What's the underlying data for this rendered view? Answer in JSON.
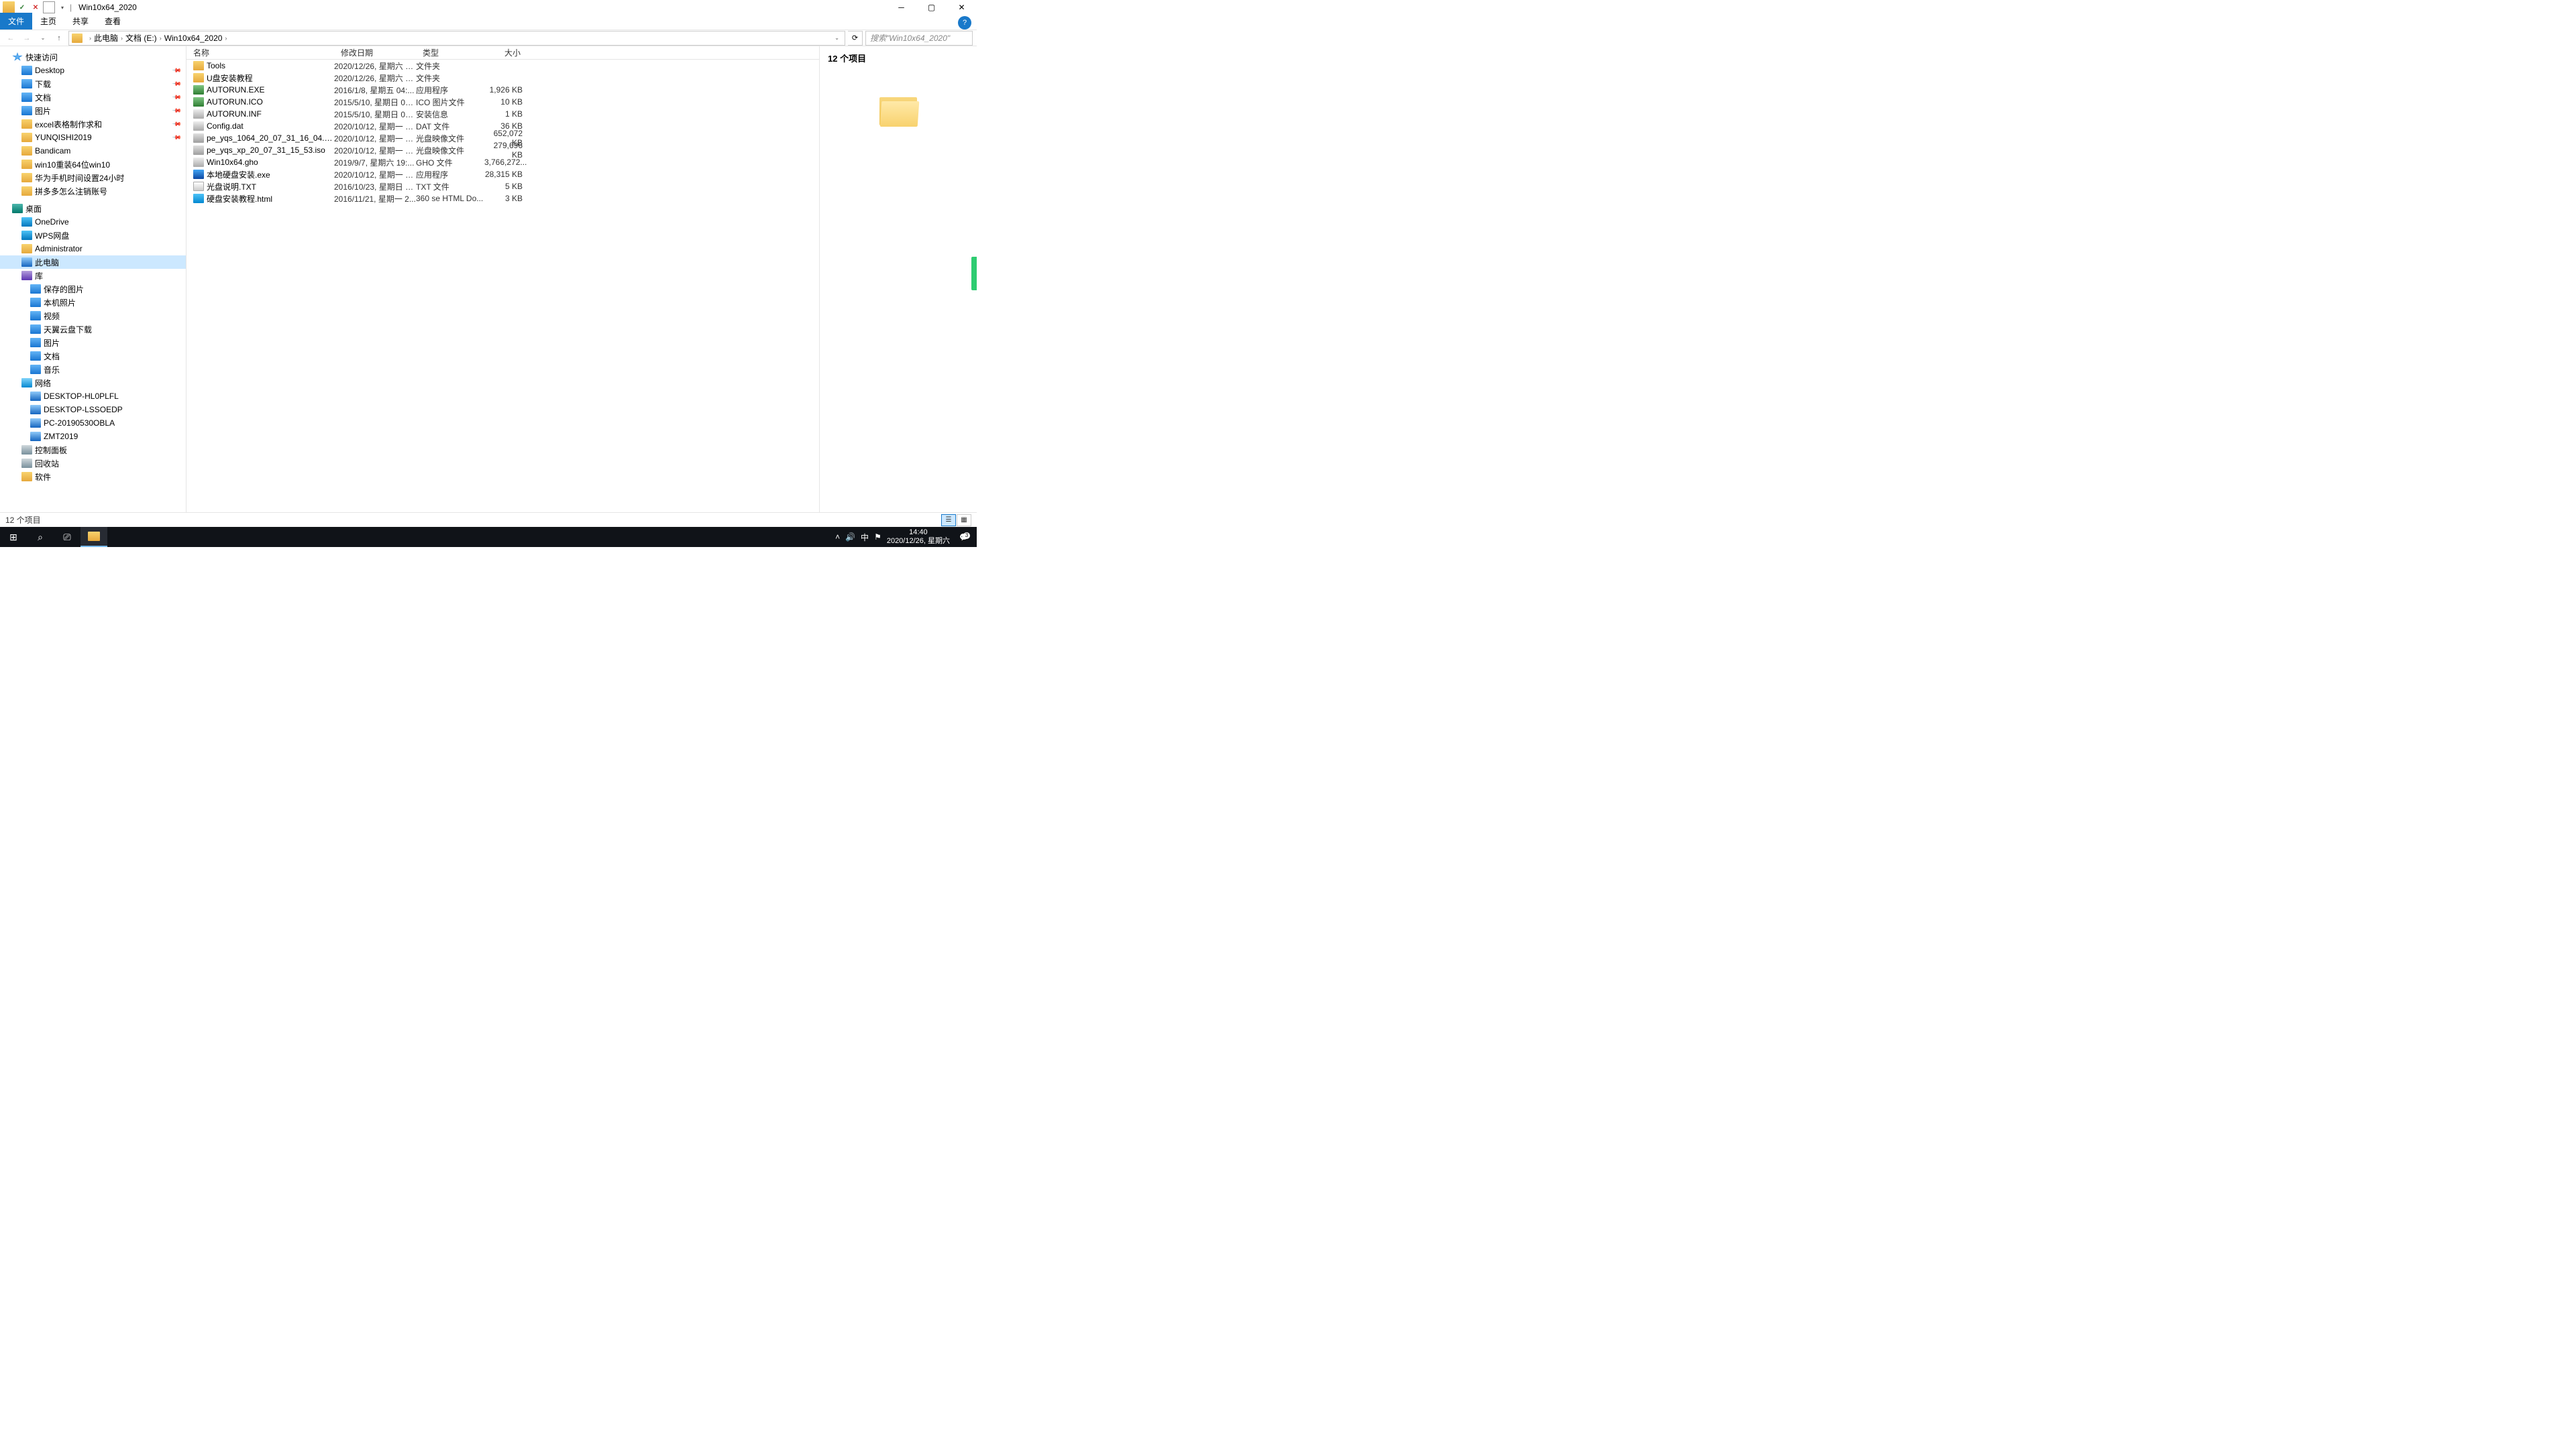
{
  "window": {
    "title": "Win10x64_2020"
  },
  "ribbon": {
    "tabs": [
      "文件",
      "主页",
      "共享",
      "查看"
    ],
    "active": 0
  },
  "breadcrumb": {
    "items": [
      "此电脑",
      "文档 (E:)",
      "Win10x64_2020"
    ]
  },
  "search": {
    "placeholder": "搜索\"Win10x64_2020\""
  },
  "navtree": [
    {
      "label": "快速访问",
      "level": 1,
      "icon": "ic-star"
    },
    {
      "label": "Desktop",
      "level": 2,
      "icon": "ic-blue",
      "pin": true
    },
    {
      "label": "下载",
      "level": 2,
      "icon": "ic-blue",
      "pin": true
    },
    {
      "label": "文档",
      "level": 2,
      "icon": "ic-blue",
      "pin": true
    },
    {
      "label": "图片",
      "level": 2,
      "icon": "ic-blue",
      "pin": true
    },
    {
      "label": "excel表格制作求和",
      "level": 2,
      "icon": "ic-folder",
      "pin": true
    },
    {
      "label": "YUNQISHI2019",
      "level": 2,
      "icon": "ic-folder",
      "pin": true
    },
    {
      "label": "Bandicam",
      "level": 2,
      "icon": "ic-folder"
    },
    {
      "label": "win10重装64位win10",
      "level": 2,
      "icon": "ic-folder"
    },
    {
      "label": "华为手机时间设置24小时",
      "level": 2,
      "icon": "ic-folder"
    },
    {
      "label": "拼多多怎么注销账号",
      "level": 2,
      "icon": "ic-folder"
    },
    {
      "label": "",
      "level": 0,
      "spacer": true
    },
    {
      "label": "桌面",
      "level": 1,
      "icon": "ic-desktop"
    },
    {
      "label": "OneDrive",
      "level": 2,
      "icon": "ic-cloud"
    },
    {
      "label": "WPS网盘",
      "level": 2,
      "icon": "ic-cloud"
    },
    {
      "label": "Administrator",
      "level": 2,
      "icon": "ic-folder"
    },
    {
      "label": "此电脑",
      "level": 2,
      "icon": "ic-pc",
      "selected": true
    },
    {
      "label": "库",
      "level": 2,
      "icon": "ic-lib"
    },
    {
      "label": "保存的图片",
      "level": 3,
      "icon": "ic-blue"
    },
    {
      "label": "本机照片",
      "level": 3,
      "icon": "ic-blue"
    },
    {
      "label": "视频",
      "level": 3,
      "icon": "ic-blue"
    },
    {
      "label": "天翼云盘下载",
      "level": 3,
      "icon": "ic-blue"
    },
    {
      "label": "图片",
      "level": 3,
      "icon": "ic-blue"
    },
    {
      "label": "文档",
      "level": 3,
      "icon": "ic-blue"
    },
    {
      "label": "音乐",
      "level": 3,
      "icon": "ic-blue"
    },
    {
      "label": "网络",
      "level": 2,
      "icon": "ic-net"
    },
    {
      "label": "DESKTOP-HL0PLFL",
      "level": 3,
      "icon": "ic-pc"
    },
    {
      "label": "DESKTOP-LSSOEDP",
      "level": 3,
      "icon": "ic-pc"
    },
    {
      "label": "PC-20190530OBLA",
      "level": 3,
      "icon": "ic-pc"
    },
    {
      "label": "ZMT2019",
      "level": 3,
      "icon": "ic-pc"
    },
    {
      "label": "控制面板",
      "level": 2,
      "icon": "ic-disk"
    },
    {
      "label": "回收站",
      "level": 2,
      "icon": "ic-disk"
    },
    {
      "label": "软件",
      "level": 2,
      "icon": "ic-folder"
    }
  ],
  "columns": {
    "name": "名称",
    "date": "修改日期",
    "type": "类型",
    "size": "大小"
  },
  "files": [
    {
      "name": "Tools",
      "date": "2020/12/26, 星期六 1...",
      "type": "文件夹",
      "size": "",
      "icon": "ic-folder"
    },
    {
      "name": "U盘安装教程",
      "date": "2020/12/26, 星期六 1...",
      "type": "文件夹",
      "size": "",
      "icon": "ic-folder"
    },
    {
      "name": "AUTORUN.EXE",
      "date": "2016/1/8, 星期五 04:...",
      "type": "应用程序",
      "size": "1,926 KB",
      "icon": "ic-exe"
    },
    {
      "name": "AUTORUN.ICO",
      "date": "2015/5/10, 星期日 02...",
      "type": "ICO 图片文件",
      "size": "10 KB",
      "icon": "ic-exe"
    },
    {
      "name": "AUTORUN.INF",
      "date": "2015/5/10, 星期日 02...",
      "type": "安装信息",
      "size": "1 KB",
      "icon": "ic-dat"
    },
    {
      "name": "Config.dat",
      "date": "2020/10/12, 星期一 1...",
      "type": "DAT 文件",
      "size": "36 KB",
      "icon": "ic-dat"
    },
    {
      "name": "pe_yqs_1064_20_07_31_16_04.iso",
      "date": "2020/10/12, 星期一 1...",
      "type": "光盘映像文件",
      "size": "652,072 KB",
      "icon": "ic-iso"
    },
    {
      "name": "pe_yqs_xp_20_07_31_15_53.iso",
      "date": "2020/10/12, 星期一 1...",
      "type": "光盘映像文件",
      "size": "279,696 KB",
      "icon": "ic-iso"
    },
    {
      "name": "Win10x64.gho",
      "date": "2019/9/7, 星期六 19:...",
      "type": "GHO 文件",
      "size": "3,766,272...",
      "icon": "ic-dat"
    },
    {
      "name": "本地硬盘安装.exe",
      "date": "2020/10/12, 星期一 1...",
      "type": "应用程序",
      "size": "28,315 KB",
      "icon": "ic-app"
    },
    {
      "name": "光盘说明.TXT",
      "date": "2016/10/23, 星期日 0...",
      "type": "TXT 文件",
      "size": "5 KB",
      "icon": "ic-txt"
    },
    {
      "name": "硬盘安装教程.html",
      "date": "2016/11/21, 星期一 2...",
      "type": "360 se HTML Do...",
      "size": "3 KB",
      "icon": "ic-html"
    }
  ],
  "preview": {
    "count": "12 个项目"
  },
  "statusbar": {
    "text": "12 个项目"
  },
  "taskbar": {
    "time": "14:40",
    "date": "2020/12/26, 星期六",
    "ime": "中",
    "notif_count": "3"
  }
}
